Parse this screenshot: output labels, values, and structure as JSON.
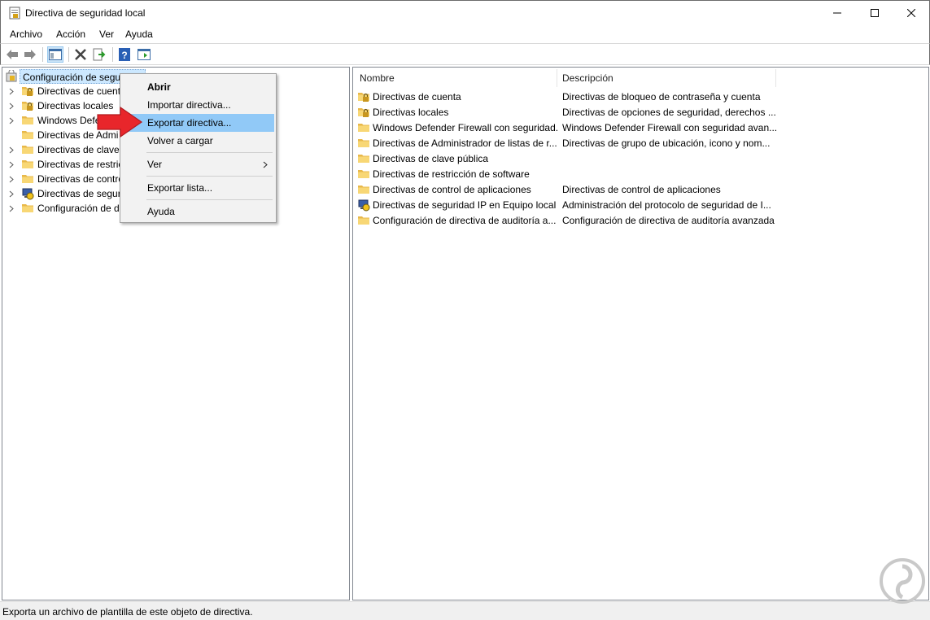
{
  "window": {
    "title": "Directiva de seguridad local",
    "controls": {
      "minimize": "minimize-icon",
      "maximize": "maximize-icon",
      "close": "close-icon"
    }
  },
  "menubar": {
    "items": [
      "Archivo",
      "Acción",
      "Ver",
      "Ayuda"
    ]
  },
  "toolbar": {
    "buttons": [
      "back-arrow-icon",
      "forward-arrow-icon",
      "show-hide-tree-icon",
      "delete-icon",
      "export-list-icon",
      "help-icon",
      "action-pane-icon"
    ]
  },
  "tree": {
    "root": {
      "label": "Configuración de seguridad",
      "icon": "security-settings-icon"
    },
    "items": [
      {
        "label": "Directivas de cuent",
        "icon": "folder-lock-icon"
      },
      {
        "label": "Directivas locales",
        "icon": "folder-lock-icon"
      },
      {
        "label": "Windows Defender",
        "icon": "folder-icon"
      },
      {
        "label": "Directivas de Admi",
        "icon": "folder-icon"
      },
      {
        "label": "Directivas de clave",
        "icon": "folder-icon"
      },
      {
        "label": "Directivas de restric",
        "icon": "folder-icon"
      },
      {
        "label": "Directivas de contro",
        "icon": "folder-icon"
      },
      {
        "label": "Directivas de segur",
        "icon": "ip-security-icon"
      },
      {
        "label": "Configuración de d",
        "icon": "folder-icon"
      }
    ]
  },
  "list": {
    "columns": [
      "Nombre",
      "Descripción"
    ],
    "rows": [
      {
        "name": "Directivas de cuenta",
        "description": "Directivas de bloqueo de contraseña y cuenta",
        "icon": "folder-lock-icon"
      },
      {
        "name": "Directivas locales",
        "description": "Directivas de opciones de seguridad, derechos ...",
        "icon": "folder-lock-icon"
      },
      {
        "name": "Windows Defender Firewall con seguridad...",
        "description": "Windows Defender Firewall con seguridad avan...",
        "icon": "folder-icon"
      },
      {
        "name": "Directivas de Administrador de listas de r...",
        "description": "Directivas de grupo de ubicación, icono y nom...",
        "icon": "folder-icon"
      },
      {
        "name": "Directivas de clave pública",
        "description": "",
        "icon": "folder-icon"
      },
      {
        "name": "Directivas de restricción de software",
        "description": "",
        "icon": "folder-icon"
      },
      {
        "name": "Directivas de control de aplicaciones",
        "description": "Directivas de control de aplicaciones",
        "icon": "folder-icon"
      },
      {
        "name": "Directivas de seguridad IP en Equipo local",
        "description": "Administración del protocolo de seguridad de I...",
        "icon": "ip-security-icon"
      },
      {
        "name": "Configuración de directiva de auditoría a...",
        "description": "Configuración de directiva de auditoría avanzada",
        "icon": "folder-icon"
      }
    ]
  },
  "context_menu": {
    "items": [
      "Abrir",
      "Importar directiva...",
      "Exportar directiva...",
      "Volver a cargar",
      "Ver",
      "Exportar lista...",
      "Ayuda"
    ],
    "highlighted": "Exportar directiva..."
  },
  "statusbar": {
    "text": "Exporta un archivo de plantilla de este objeto de directiva."
  },
  "colors": {
    "selection": "#cce8ff",
    "menu_hover": "#91c9f7",
    "annotation_arrow": "#e8262b",
    "folder": "#f3d36b"
  }
}
